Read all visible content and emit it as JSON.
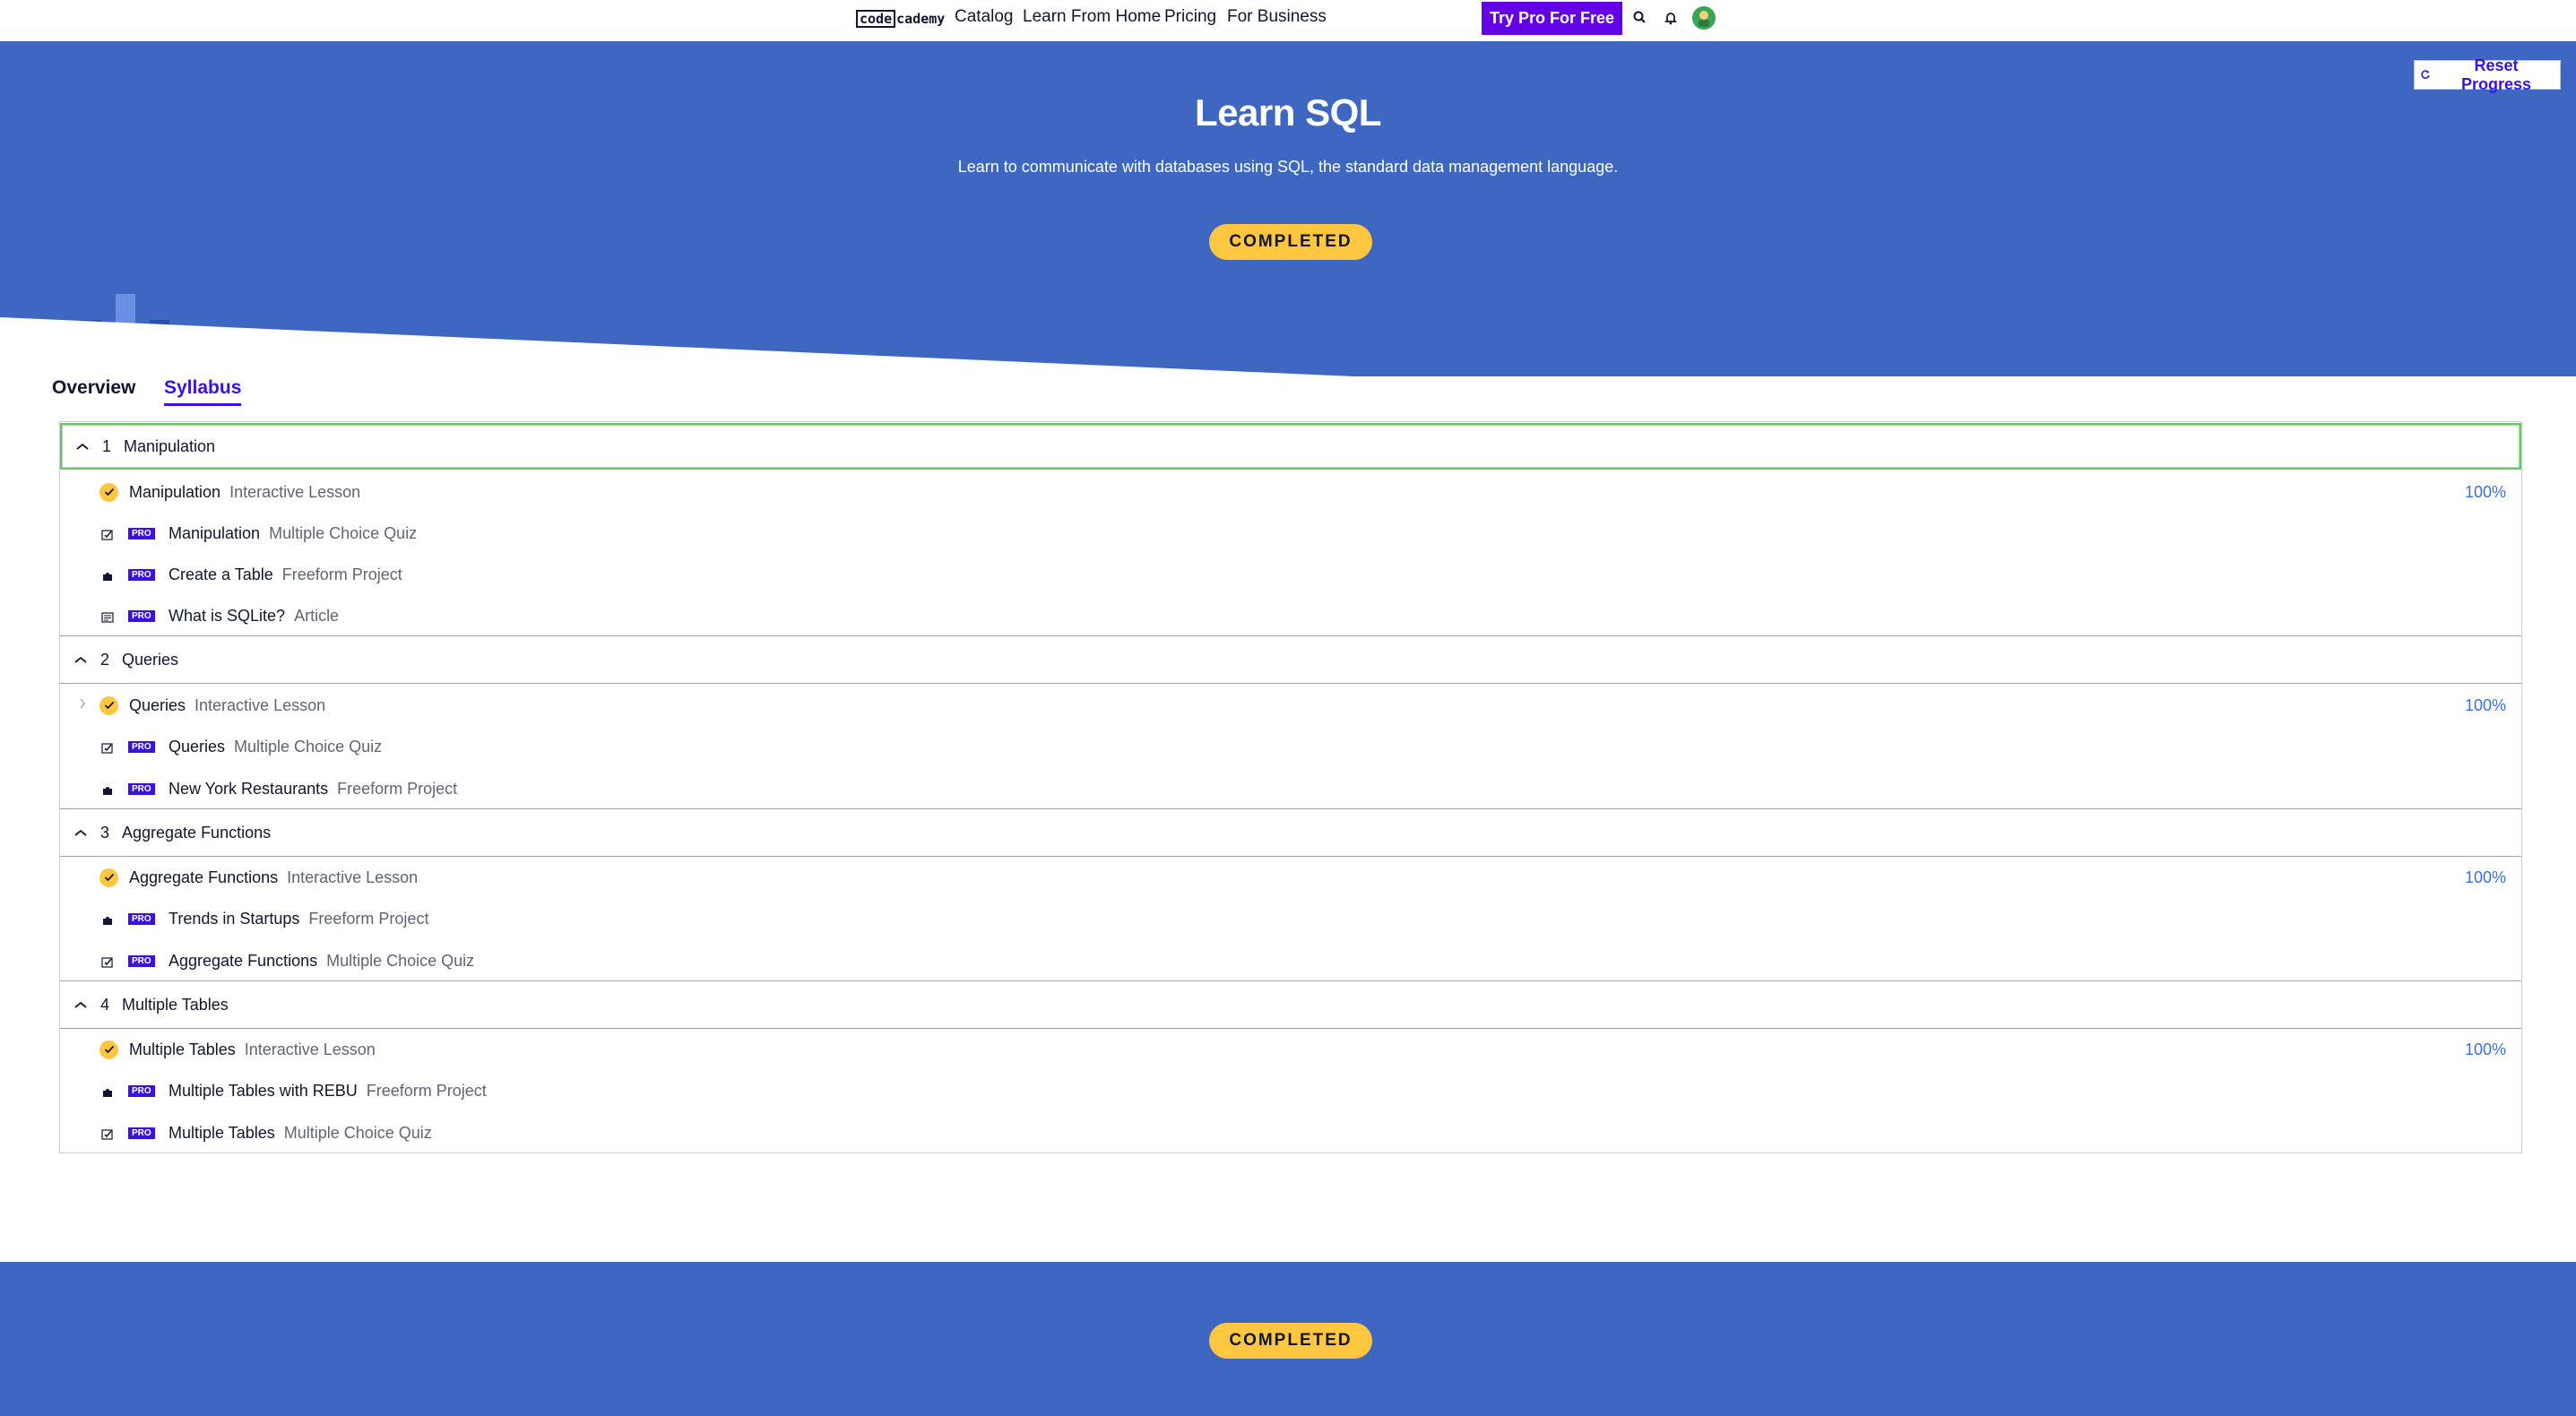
{
  "nav": {
    "logo_code": "code",
    "logo_cademy": "cademy",
    "links": [
      "Catalog",
      "Learn From Home",
      "Pricing",
      "For Business"
    ],
    "try_pro": "Try Pro For Free",
    "icons": [
      "search-icon",
      "bell-icon",
      "avatar"
    ]
  },
  "hero": {
    "reset": "Reset Progress",
    "title": "Learn SQL",
    "description": "Learn to communicate with databases using SQL, the standard data management language.",
    "status": "COMPLETED"
  },
  "tabs": {
    "overview": "Overview",
    "syllabus": "Syllabus"
  },
  "modules": [
    {
      "number": "1",
      "title": "Manipulation",
      "items": [
        {
          "title": "Manipulation",
          "kind": "Interactive Lesson",
          "pro": false,
          "progress": "100%",
          "icon": "check-icon"
        },
        {
          "title": "Manipulation",
          "kind": "Multiple Choice Quiz",
          "pro": true,
          "icon": "quiz-icon"
        },
        {
          "title": "Create a Table",
          "kind": "Freeform Project",
          "pro": true,
          "icon": "puzzle-icon"
        },
        {
          "title": "What is SQLite?",
          "kind": "Article",
          "pro": true,
          "icon": "article-icon"
        }
      ]
    },
    {
      "number": "2",
      "title": "Queries",
      "items": [
        {
          "title": "Queries",
          "kind": "Interactive Lesson",
          "pro": false,
          "progress": "100%",
          "icon": "check-icon"
        },
        {
          "title": "Queries",
          "kind": "Multiple Choice Quiz",
          "pro": true,
          "icon": "quiz-icon"
        },
        {
          "title": "New York Restaurants",
          "kind": "Freeform Project",
          "pro": true,
          "icon": "puzzle-icon"
        }
      ]
    },
    {
      "number": "3",
      "title": "Aggregate Functions",
      "items": [
        {
          "title": "Aggregate Functions",
          "kind": "Interactive Lesson",
          "pro": false,
          "progress": "100%",
          "icon": "check-icon"
        },
        {
          "title": "Trends in Startups",
          "kind": "Freeform Project",
          "pro": true,
          "icon": "puzzle-icon"
        },
        {
          "title": "Aggregate Functions",
          "kind": "Multiple Choice Quiz",
          "pro": true,
          "icon": "quiz-icon"
        }
      ]
    },
    {
      "number": "4",
      "title": "Multiple Tables",
      "items": [
        {
          "title": "Multiple Tables",
          "kind": "Interactive Lesson",
          "pro": false,
          "progress": "100%",
          "icon": "check-icon"
        },
        {
          "title": "Multiple Tables with REBU",
          "kind": "Freeform Project",
          "pro": true,
          "icon": "puzzle-icon"
        },
        {
          "title": "Multiple Tables",
          "kind": "Multiple Choice Quiz",
          "pro": true,
          "icon": "quiz-icon"
        }
      ]
    }
  ],
  "pro_label": "PRO",
  "footer": {
    "status": "COMPLETED"
  },
  "colors": {
    "hero": "#3e67c2",
    "accent": "#3a10e5",
    "badge": "#ffc740",
    "pro_button": "#6400e4"
  }
}
